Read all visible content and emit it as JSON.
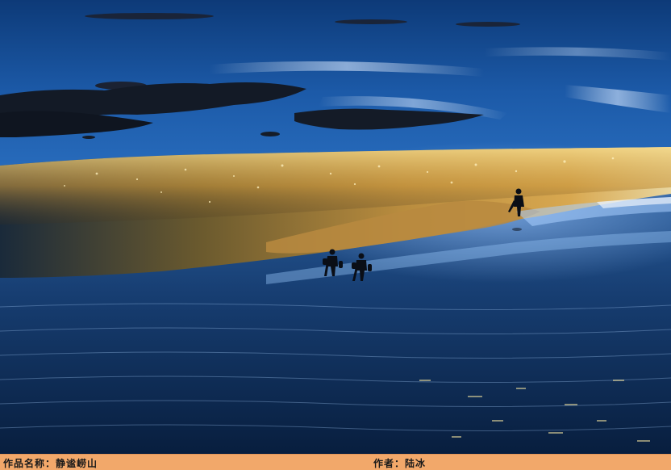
{
  "caption": {
    "title_label": "作品名称：",
    "title_value": "静谧崂山",
    "author_label": "作者：",
    "author_value": "陆冰"
  },
  "colors": {
    "caption_bar": "#f2a86a",
    "deep_water": "#0b2a52",
    "sand_gold": "#c9a24a"
  }
}
